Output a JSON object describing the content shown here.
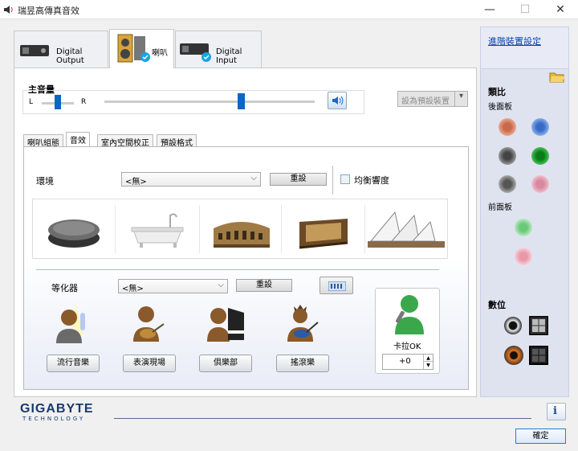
{
  "window": {
    "title": "瑞昱高傳真音效"
  },
  "device_tabs": [
    {
      "label": "Digital Output"
    },
    {
      "label": "喇叭"
    },
    {
      "label": "Digital Input"
    }
  ],
  "right_panel": {
    "advanced_link": "進階裝置設定",
    "analog_title": "類比",
    "rear_label": "後面板",
    "front_label": "前面板",
    "digital_title": "數位"
  },
  "volume": {
    "title": "主音量",
    "left": "L",
    "right": "R",
    "default_button": "設為預設裝置"
  },
  "sub_tabs": [
    {
      "label": "喇叭組態"
    },
    {
      "label": "音效"
    },
    {
      "label": "室內空間校正"
    },
    {
      "label": "預設格式"
    }
  ],
  "environment": {
    "label": "環境",
    "value": "<無>",
    "reset": "重設",
    "loudness": "均衡響度"
  },
  "equalizer": {
    "label": "等化器",
    "value": "<無>",
    "reset": "重設"
  },
  "presets": [
    {
      "label": "流行音樂"
    },
    {
      "label": "表演現場"
    },
    {
      "label": "俱樂部"
    },
    {
      "label": "搖滾樂"
    }
  ],
  "karaoke": {
    "label": "卡拉OK",
    "value": "+0"
  },
  "brand": {
    "name": "GIGABYTE",
    "sub": "TECHNOLOGY"
  },
  "ok_button": "確定",
  "colors": {
    "accent": "#0b66c6",
    "panel": "#dfe3f0",
    "link": "#0645ad"
  }
}
